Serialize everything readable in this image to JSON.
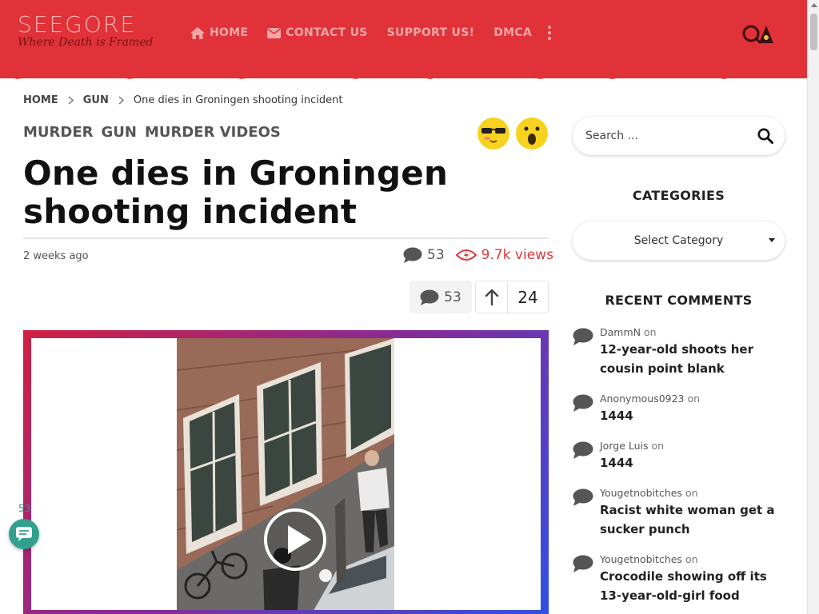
{
  "site": {
    "title": "SEEGORE",
    "tagline": "Where Death is Framed"
  },
  "nav": {
    "items": [
      {
        "label": "HOME",
        "icon": "home-icon"
      },
      {
        "label": "CONTACT US",
        "icon": "envelope-icon"
      },
      {
        "label": "SUPPORT US!",
        "icon": ""
      },
      {
        "label": "DMCA",
        "icon": ""
      }
    ],
    "more_icon": "kebab-icon"
  },
  "breadcrumb": {
    "items": [
      "HOME",
      "GUN"
    ],
    "current": "One dies in Groningen shooting incident"
  },
  "post": {
    "categories": [
      "MURDER",
      "GUN",
      "MURDER VIDEOS"
    ],
    "title": "One dies in Groningen shooting incident",
    "date": "2 weeks ago",
    "comment_count": "53",
    "views": "9.7k views",
    "vote_count": "24"
  },
  "floating": {
    "comment_count": "53"
  },
  "sidebar": {
    "search_placeholder": "Search ...",
    "categories_heading": "CATEGORIES",
    "category_select": "Select Category",
    "recent_heading": "RECENT COMMENTS",
    "on_label": "on",
    "recent_comments": [
      {
        "author": "DammN",
        "post": "12-year-old shoots her cousin point blank"
      },
      {
        "author": "Anonymous0923",
        "post": "1444"
      },
      {
        "author": "Jorge Luis",
        "post": "1444"
      },
      {
        "author": "Yougetnobitches",
        "post": "Racist white woman get a sucker punch"
      },
      {
        "author": "Yougetnobitches",
        "post": "Crocodile showing off its 13-year-old-girl food"
      }
    ]
  },
  "colors": {
    "header_red": "#e03238",
    "nav_text": "#f3a5a7",
    "views_red": "#d93a3f",
    "float_green": "#31a08f"
  }
}
